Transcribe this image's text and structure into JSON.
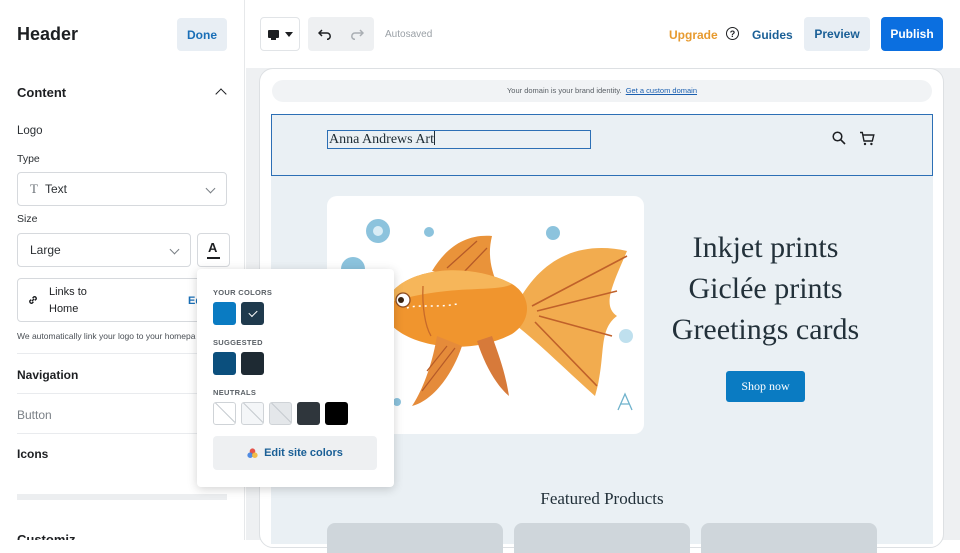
{
  "panel": {
    "title": "Header",
    "done_label": "Done",
    "content_title": "Content",
    "logo_label": "Logo",
    "type_label": "Type",
    "type_value": "Text",
    "size_label": "Size",
    "size_value": "Large",
    "links_to_label": "Links to",
    "links_to_value": "Home",
    "links_to_edit": "Ed",
    "auto_link_note": "We automatically link your logo to your homepa",
    "navigation_label": "Navigation",
    "button_label": "Button",
    "icons_label": "Icons",
    "customize_label": "Customiz"
  },
  "topbar": {
    "autosaved": "Autosaved",
    "upgrade": "Upgrade",
    "guides": "Guides",
    "preview": "Preview",
    "publish": "Publish"
  },
  "site": {
    "domain_note": "Your domain is your brand identity.",
    "domain_link": "Get a custom domain",
    "logo_text": "Anna Andrews Art",
    "hero_lines": [
      "Inkjet prints",
      "Giclée prints",
      "Greetings cards"
    ],
    "shop_now": "Shop now",
    "featured_title": "Featured Products"
  },
  "colors_popup": {
    "your_colors_label": "YOUR COLORS",
    "your_colors": [
      "#0a7bc2",
      "#1f3a4d"
    ],
    "suggested_label": "SUGGESTED",
    "suggested": [
      "#0b4f7d",
      "#1e2a33"
    ],
    "neutrals_label": "NEUTRALS",
    "neutrals": [
      "#ffffff",
      "#f4f6f8",
      "#e4e7ea",
      "#2f363c",
      "#000000"
    ],
    "edit_label": "Edit site colors"
  },
  "theme": {
    "accent": "#0b6fe0",
    "upgrade": "#e79a2e",
    "shop_button": "#0a7bc2"
  }
}
